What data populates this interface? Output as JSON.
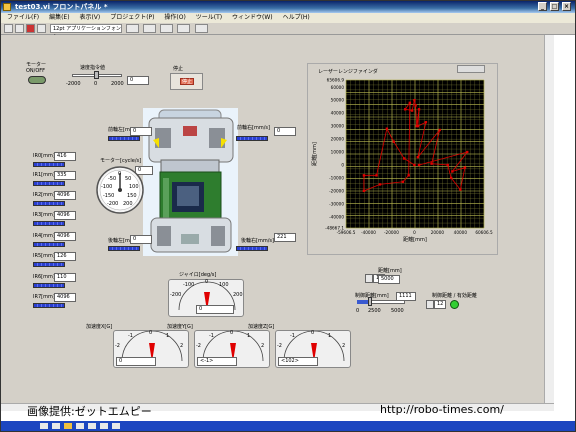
{
  "window": {
    "title": "test03.vi フロントパネル *"
  },
  "menu": [
    "ファイル(F)",
    "編集(E)",
    "表示(V)",
    "プロジェクト(P)",
    "操作(O)",
    "ツール(T)",
    "ウィンドウ(W)",
    "ヘルプ(H)"
  ],
  "toolbar": {
    "font": "12pt アプリケーションフォント"
  },
  "motor_toggle": {
    "label": "モーター\nON/OFF"
  },
  "speed_cmd": {
    "label": "速度指令値",
    "value": "0",
    "ticks": [
      "-2000",
      "0",
      "2000"
    ]
  },
  "stop": {
    "label": "停止",
    "button": "停止"
  },
  "front_left": {
    "label": "前輪左[mm/s]",
    "value": "0"
  },
  "front_right": {
    "label": "前輪右[mm/s]",
    "value": "0"
  },
  "rear_left": {
    "label": "後輪左[mm/s]",
    "value": "0"
  },
  "rear_right": {
    "label": "後輪右[mm/s]",
    "value": "221"
  },
  "motor_dial": {
    "label": "モーター[cycle/s]",
    "value": "0",
    "ticks": [
      "-50",
      "0",
      "50",
      "-100",
      "100",
      "-150",
      "150",
      "-200",
      "200"
    ]
  },
  "ir_sensors": [
    {
      "label": "IR0[mm]",
      "value": "416"
    },
    {
      "label": "IR1[mm]",
      "value": "335"
    },
    {
      "label": "IR2[mm]",
      "value": "4096"
    },
    {
      "label": "IR3[mm]",
      "value": "4096"
    },
    {
      "label": "IR4[mm]",
      "value": "4096"
    },
    {
      "label": "IR5[mm]",
      "value": "126"
    },
    {
      "label": "IR6[mm]",
      "value": "110"
    },
    {
      "label": "IR7[mm]",
      "value": "4096"
    }
  ],
  "gyro": {
    "label": "ジャイロ[deg/s]",
    "value": "0",
    "ticks": [
      "-100",
      "0",
      "100",
      "-200",
      "200"
    ]
  },
  "accel": [
    {
      "label": "加速度X[G]",
      "value": "0",
      "ticks": [
        "-1",
        "0",
        "1",
        "-2",
        "2"
      ]
    },
    {
      "label": "加速度Y[G]",
      "value": "<-1>",
      "ticks": [
        "-1",
        "0",
        "1",
        "-2",
        "2"
      ]
    },
    {
      "label": "加速度Z[G]",
      "value": "<102>",
      "ticks": [
        "-1",
        "0",
        "1",
        "-2",
        "2"
      ]
    }
  ],
  "distance": {
    "label": "距離[mm]",
    "stepper": "12",
    "value": "5000"
  },
  "range": {
    "label": "制御距離[mm]",
    "value": "1111",
    "ticks": [
      "0",
      "2500",
      "5000"
    ]
  },
  "range_display": {
    "label": "制御距離 / 有効距離",
    "stepper": "12"
  },
  "lrf": {
    "title": "レーザーレンジファインダ",
    "xlabel": "距離[mm]",
    "ylabel": "距離[mm]"
  },
  "chart_data": {
    "type": "scatter",
    "title": "レーザーレンジファインダ",
    "xlabel": "距離[mm]",
    "ylabel": "距離[mm]",
    "xlim": [
      -59606.5,
      60606.5
    ],
    "ylim": [
      -48667.1,
      65606.9
    ],
    "xticks": [
      "-59606.5",
      "-40000",
      "-20000",
      "0",
      "20000",
      "40000",
      "60606.5"
    ],
    "yticks": [
      "65606.9",
      "60000",
      "50000",
      "40000",
      "30000",
      "20000",
      "10000",
      "0",
      "-10000",
      "-20000",
      "-30000",
      "-40000",
      "-48667.1"
    ],
    "series": [
      {
        "color": "#e00000",
        "points": [
          [
            0,
            0
          ],
          [
            -9000,
            5000
          ],
          [
            -18000,
            18000
          ],
          [
            -24000,
            28000
          ],
          [
            -33000,
            -8000
          ],
          [
            -44000,
            -8000
          ],
          [
            -44000,
            -20000
          ],
          [
            -30000,
            -15000
          ],
          [
            -10000,
            -13000
          ],
          [
            -5000,
            -8000
          ],
          [
            -4000,
            48000
          ],
          [
            -8000,
            43000
          ],
          [
            -2000,
            42000
          ],
          [
            0,
            50000
          ],
          [
            1000,
            46000
          ],
          [
            2000,
            30000
          ],
          [
            4000,
            43000
          ],
          [
            3000,
            30000
          ],
          [
            10000,
            33000
          ],
          [
            3000,
            6000
          ],
          [
            22000,
            27000
          ],
          [
            15000,
            1000
          ],
          [
            29000,
            0
          ],
          [
            32000,
            -10000
          ],
          [
            40000,
            -19000
          ],
          [
            44000,
            -2000
          ],
          [
            33000,
            -5000
          ],
          [
            46000,
            10000
          ],
          [
            4000,
            0
          ]
        ]
      }
    ]
  },
  "overlay": {
    "credit": "画像提供:ゼットエムピー",
    "url": "http://robo-times.com/"
  },
  "colors": {
    "plot_bg": "#000000",
    "grid": "#8a8a3a",
    "points": "#e00000",
    "indicator_bar": "#2a3fd0",
    "title_bar": "#0a246a"
  }
}
